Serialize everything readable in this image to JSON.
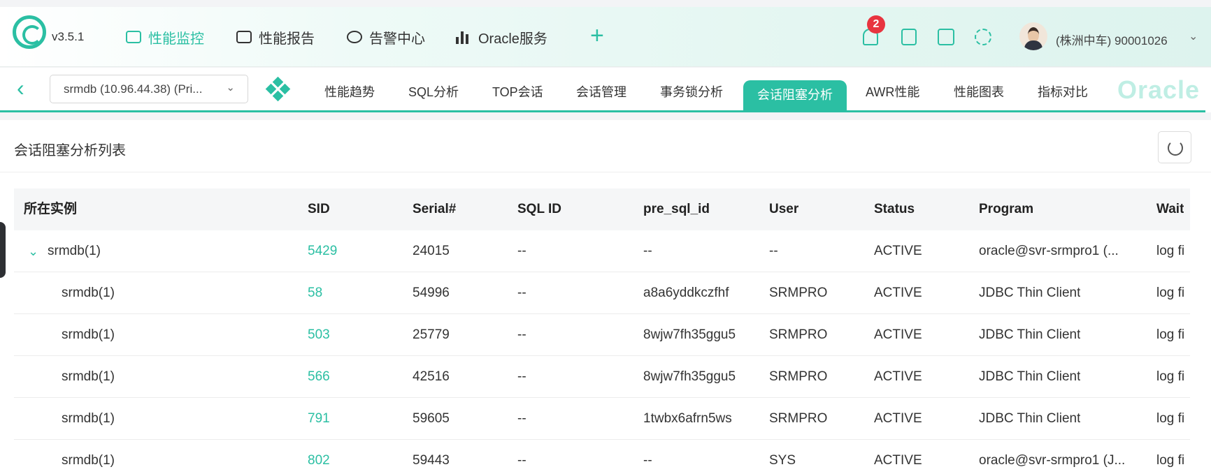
{
  "app": {
    "version": "v3.5.1"
  },
  "nav": [
    {
      "label": "性能监控",
      "active": true
    },
    {
      "label": "性能报告",
      "active": false
    },
    {
      "label": "告警中心",
      "active": false
    },
    {
      "label": "Oracle服务",
      "active": false
    }
  ],
  "toolbar": {
    "notification_count": "2",
    "user_name": "(株洲中车) 90001026"
  },
  "instance_select": {
    "value": "srmdb (10.96.44.38) (Pri..."
  },
  "tabs": [
    {
      "label": "性能趋势",
      "active": false
    },
    {
      "label": "SQL分析",
      "active": false
    },
    {
      "label": "TOP会话",
      "active": false
    },
    {
      "label": "会话管理",
      "active": false
    },
    {
      "label": "事务锁分析",
      "active": false
    },
    {
      "label": "会话阻塞分析",
      "active": true
    },
    {
      "label": "AWR性能",
      "active": false
    },
    {
      "label": "性能图表",
      "active": false
    },
    {
      "label": "指标对比",
      "active": false
    }
  ],
  "brand_text": "Oracle",
  "panel": {
    "title": "会话阻塞分析列表"
  },
  "table": {
    "columns": [
      "所在实例",
      "SID",
      "Serial#",
      "SQL ID",
      "pre_sql_id",
      "User",
      "Status",
      "Program",
      "Wait"
    ],
    "rows": [
      {
        "instance": "srmdb(1)",
        "sid": "5429",
        "serial": "24015",
        "sql_id": "--",
        "pre_sql_id": "--",
        "user": "--",
        "status": "ACTIVE",
        "program": "oracle@svr-srmpro1 (...",
        "wait": "log fi",
        "parent": true
      },
      {
        "instance": "srmdb(1)",
        "sid": "58",
        "serial": "54996",
        "sql_id": "--",
        "pre_sql_id": "a8a6yddkczfhf",
        "user": "SRMPRO",
        "status": "ACTIVE",
        "program": "JDBC Thin Client",
        "wait": "log fi",
        "parent": false
      },
      {
        "instance": "srmdb(1)",
        "sid": "503",
        "serial": "25779",
        "sql_id": "--",
        "pre_sql_id": "8wjw7fh35ggu5",
        "user": "SRMPRO",
        "status": "ACTIVE",
        "program": "JDBC Thin Client",
        "wait": "log fi",
        "parent": false
      },
      {
        "instance": "srmdb(1)",
        "sid": "566",
        "serial": "42516",
        "sql_id": "--",
        "pre_sql_id": "8wjw7fh35ggu5",
        "user": "SRMPRO",
        "status": "ACTIVE",
        "program": "JDBC Thin Client",
        "wait": "log fi",
        "parent": false
      },
      {
        "instance": "srmdb(1)",
        "sid": "791",
        "serial": "59605",
        "sql_id": "--",
        "pre_sql_id": "1twbx6afrn5ws",
        "user": "SRMPRO",
        "status": "ACTIVE",
        "program": "JDBC Thin Client",
        "wait": "log fi",
        "parent": false
      },
      {
        "instance": "srmdb(1)",
        "sid": "802",
        "serial": "59443",
        "sql_id": "--",
        "pre_sql_id": "--",
        "user": "SYS",
        "status": "ACTIVE",
        "program": "oracle@svr-srmpro1 (J...",
        "wait": "log fi",
        "parent": false
      }
    ]
  },
  "colors": {
    "accent": "#2bbfa3",
    "badge": "#e8343f"
  },
  "icons": [
    "logo-icon",
    "monitor-icon",
    "report-icon",
    "alarm-icon",
    "oracle-service-icon",
    "plus-icon",
    "bell-icon",
    "clipboard-icon",
    "dashboard-icon",
    "gear-icon",
    "avatar",
    "chevron-down-icon",
    "back-icon",
    "diamond-icon",
    "refresh-icon"
  ]
}
